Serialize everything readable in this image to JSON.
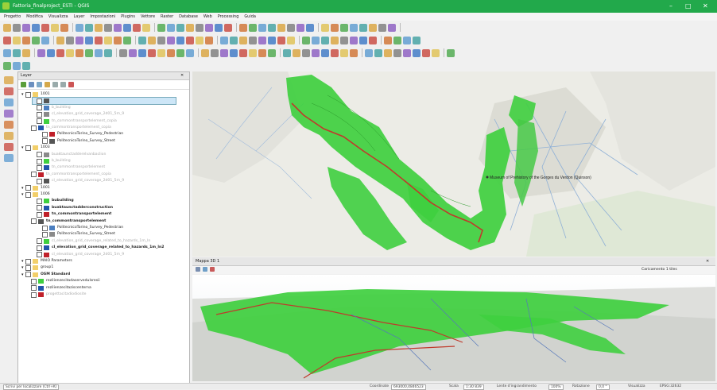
{
  "window": {
    "title": "Fattoria_finalproject_ESTI - QGIS",
    "minimize": "–",
    "maximize": "□",
    "close": "✕"
  },
  "menu": [
    "Progetto",
    "Modifica",
    "Visualizza",
    "Layer",
    "Impostazioni",
    "Plugins",
    "Vettore",
    "Raster",
    "Database",
    "Web",
    "Processing",
    "Guida"
  ],
  "layers_panel": {
    "title": "Layer",
    "close": "✕",
    "rows": [
      {
        "label": "1001",
        "indent": 0,
        "type": "group"
      },
      {
        "label": "",
        "indent": 2,
        "type": "layer-selected"
      },
      {
        "label": "b_building",
        "indent": 2,
        "type": "grey"
      },
      {
        "label": "cl_elevation_grid_coverage_2d01_5m_9",
        "indent": 2,
        "type": "grey"
      },
      {
        "label": "tn_commontransportelement_copia",
        "indent": 2,
        "type": "grey"
      },
      {
        "label": "tn_commontransportelement_copia",
        "indent": 1,
        "type": "grey"
      },
      {
        "label": "PolitecnicoTorino_Survey_Pedestrian",
        "indent": 3,
        "type": "normal"
      },
      {
        "label": "PolitecnicoTorino_Survey_Street",
        "indent": 3,
        "type": "normal"
      },
      {
        "label": "1003",
        "indent": 0,
        "type": "group"
      },
      {
        "label": "buaktaunctadderelvanbaclion",
        "indent": 2,
        "type": "grey"
      },
      {
        "label": "b_building",
        "indent": 2,
        "type": "grey"
      },
      {
        "label": "tn_commontransportelement",
        "indent": 2,
        "type": "grey"
      },
      {
        "label": "tn_commontransportelement_copia",
        "indent": 1,
        "type": "grey"
      },
      {
        "label": "cl_elevation_grid_coverage_2d01_5m_9",
        "indent": 2,
        "type": "grey"
      },
      {
        "label": "1001",
        "indent": 0,
        "type": "group"
      },
      {
        "label": "1006",
        "indent": 0,
        "type": "group"
      },
      {
        "label": "bubuilding",
        "indent": 2,
        "type": "bold"
      },
      {
        "label": "buaktaunctadderconstruction",
        "indent": 2,
        "type": "bold"
      },
      {
        "label": "tn_commontransportelement",
        "indent": 2,
        "type": "bold"
      },
      {
        "label": "tn_commontransportelement",
        "indent": 1,
        "type": "bold"
      },
      {
        "label": "PolitecnicoTorino_Survey_Pedestrian",
        "indent": 3,
        "type": "normal"
      },
      {
        "label": "PolitecnicoTorino_Survey_Street",
        "indent": 3,
        "type": "normal"
      },
      {
        "label": "cl_elevation_grid_coverage_related_to_hazards_1m_ln",
        "indent": 2,
        "type": "grey"
      },
      {
        "label": "cl_elevation_grid_coverage_related_to_hazards_1m_ln2",
        "indent": 2,
        "type": "bold"
      },
      {
        "label": "cl_elevation_grid_coverage_2d01_5m_9",
        "indent": 2,
        "type": "grey"
      },
      {
        "label": "MAIO Parameters",
        "indent": 0,
        "type": "group"
      },
      {
        "label": "group1",
        "indent": 0,
        "type": "group"
      },
      {
        "label": "OSM Standard",
        "indent": 0,
        "type": "groupbold"
      },
      {
        "label": "rezilienzecitadaservedulsresii",
        "indent": 1,
        "type": "normal"
      },
      {
        "label": "rezilienzecitaziscenterna",
        "indent": 1,
        "type": "normal"
      },
      {
        "label": "progettacitadiodiosite",
        "indent": 1,
        "type": "grey"
      }
    ]
  },
  "map": {
    "label": "Museum of Prehistory of the Gorges du Verdon (Quinson)",
    "accent": "#3fcf3f",
    "road": "#c0392b"
  },
  "view3d": {
    "title": "Mappa 3D 1",
    "close": "✕",
    "loading": "Caricamento 1 tiles"
  },
  "statusbar": {
    "locator": "Scrivi per localizzare (Ctrl+K)",
    "coord_label": "Coordinate",
    "coord": "693000,4846523",
    "scale_label": "Scala",
    "scale": "1:30 839",
    "magnifier_label": "Lente d'ingrandimento",
    "magnifier": "100%",
    "rotation_label": "Rotazione",
    "rotation": "0,0 °",
    "render": "Visualizza",
    "crs": "EPSG:32632"
  }
}
